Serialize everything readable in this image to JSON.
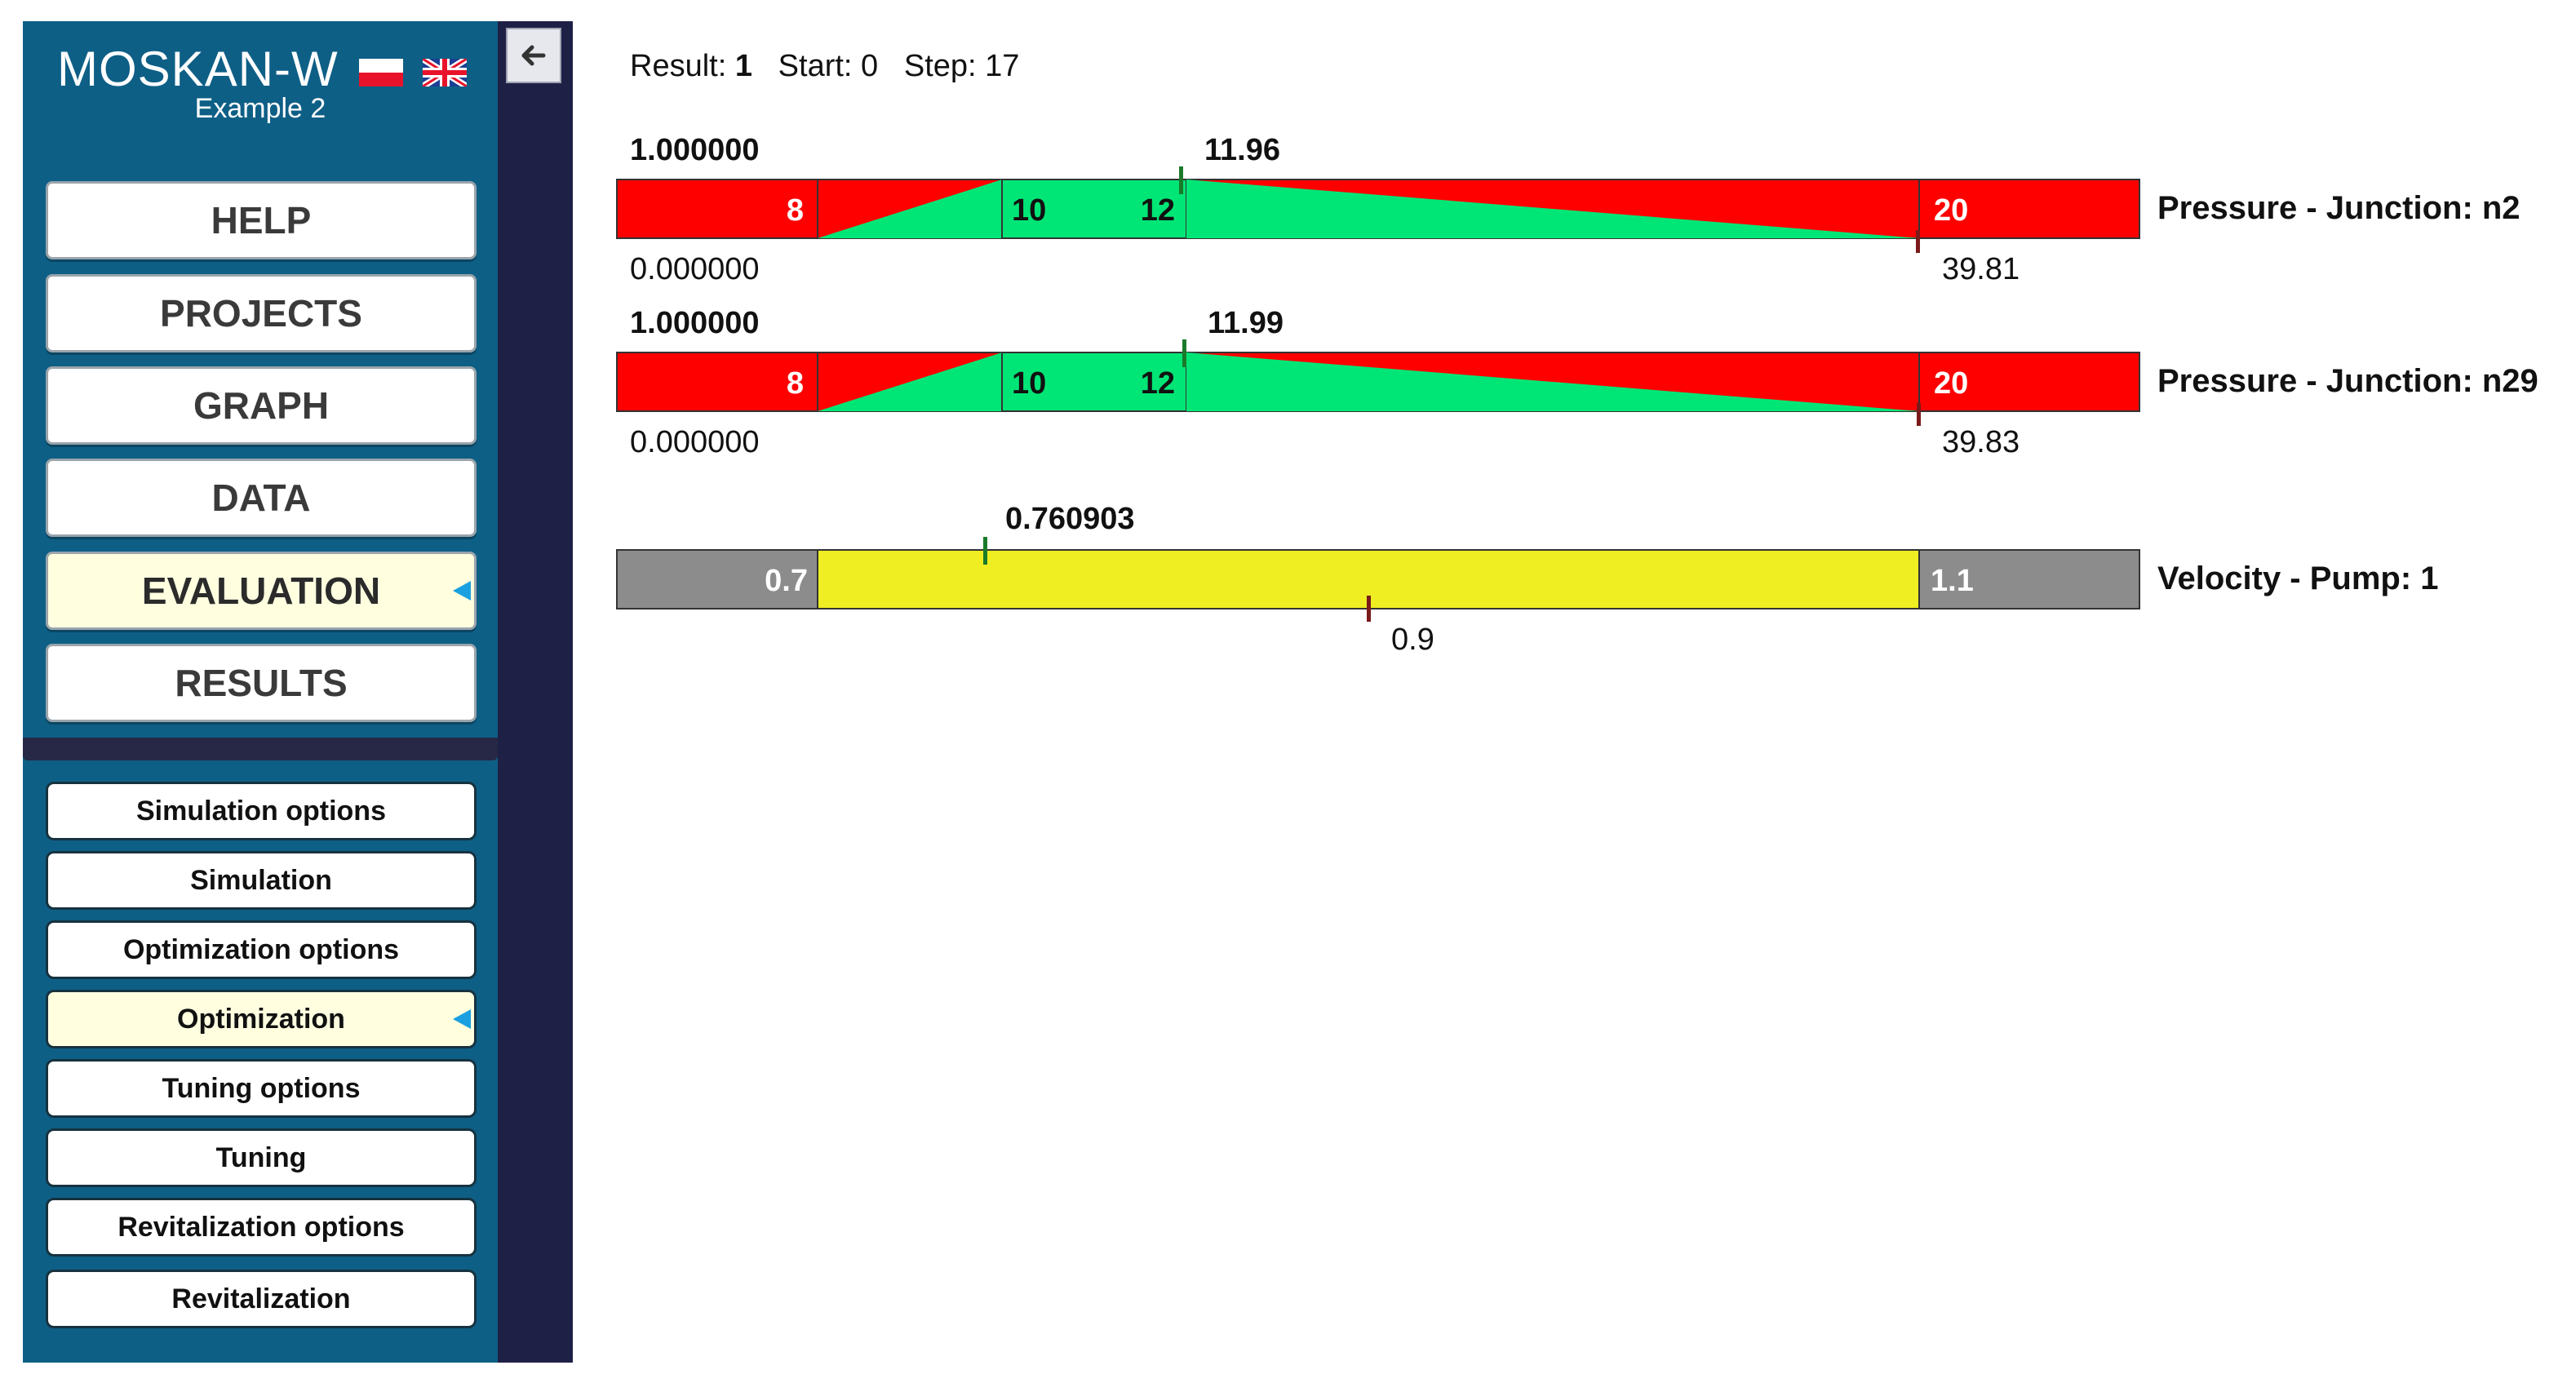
{
  "app": {
    "title": "MOSKAN-W",
    "project": "Example 2"
  },
  "nav": {
    "main": [
      {
        "label": "HELP",
        "active": false
      },
      {
        "label": "PROJECTS",
        "active": false
      },
      {
        "label": "GRAPH",
        "active": false
      },
      {
        "label": "DATA",
        "active": false
      },
      {
        "label": "EVALUATION",
        "active": true
      },
      {
        "label": "RESULTS",
        "active": false
      }
    ],
    "sub": [
      {
        "label": "Simulation options",
        "active": false
      },
      {
        "label": "Simulation",
        "active": false
      },
      {
        "label": "Optimization options",
        "active": false
      },
      {
        "label": "Optimization",
        "active": true
      },
      {
        "label": "Tuning options",
        "active": false
      },
      {
        "label": "Tuning",
        "active": false
      },
      {
        "label": "Revitalization options",
        "active": false
      },
      {
        "label": "Revitalization",
        "active": false
      }
    ]
  },
  "status": {
    "result_label": "Result:",
    "result_value": "1",
    "start_label": "Start:",
    "start_value": "0",
    "step_label": "Step:",
    "step_value": "17"
  },
  "colors": {
    "sidebar": "#0e5f86",
    "strip": "#1e2046",
    "red": "#ff0000",
    "green": "#00e676",
    "yellow": "#eeee22",
    "gray": "#8c8c8c"
  },
  "chart_data": {
    "type": "bar",
    "rows": [
      {
        "name": "Pressure - Junction: n2",
        "min_label": "0.000000",
        "max_label": "1.000000",
        "lower_limit": "8",
        "lower_opt": "10",
        "upper_opt": "12",
        "upper_limit": "20",
        "value": 11.96,
        "value_label": "11.96",
        "mark": 39.81,
        "mark_label": "39.81"
      },
      {
        "name": "Pressure - Junction: n29",
        "min_label": "0.000000",
        "max_label": "1.000000",
        "lower_limit": "8",
        "lower_opt": "10",
        "upper_opt": "12",
        "upper_limit": "20",
        "value": 11.99,
        "value_label": "11.99",
        "mark": 39.83,
        "mark_label": "39.83"
      },
      {
        "name": "Velocity - Pump: 1",
        "lower_limit": "0.7",
        "upper_limit": "1.1",
        "value": 0.760903,
        "value_label": "0.760903",
        "mark": 0.9,
        "mark_label": "0.9"
      }
    ]
  }
}
